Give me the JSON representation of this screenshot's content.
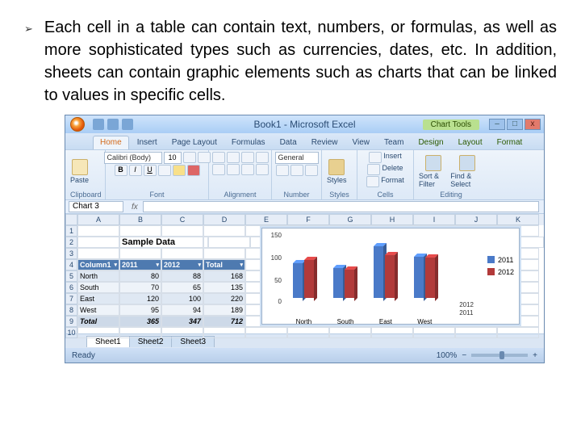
{
  "slide": {
    "bullet_text": "Each cell in a table can contain text, numbers, or formulas, as well as more sophisticated types such as currencies, dates, etc. In addition, sheets can contain graphic elements such as charts that can be linked to values in specific cells."
  },
  "titlebar": {
    "title": "Book1 - Microsoft Excel",
    "chart_tools": "Chart Tools",
    "min": "–",
    "max": "□",
    "close": "x"
  },
  "tabs": {
    "home": "Home",
    "insert": "Insert",
    "page_layout": "Page Layout",
    "formulas": "Formulas",
    "data": "Data",
    "review": "Review",
    "view": "View",
    "team": "Team",
    "design": "Design",
    "layout": "Layout",
    "format": "Format"
  },
  "ribbon": {
    "clipboard": "Clipboard",
    "paste": "Paste",
    "font_group": "Font",
    "font_name": "Calibri (Body)",
    "font_size": "10",
    "alignment": "Alignment",
    "number": "Number",
    "number_fmt": "General",
    "styles": "Styles",
    "cells": "Cells",
    "insert_btn": "Insert",
    "delete_btn": "Delete",
    "format_btn": "Format",
    "editing": "Editing",
    "sort": "Sort & Filter",
    "find": "Find & Select"
  },
  "formula": {
    "name_box": "Chart 3",
    "fx": "fx"
  },
  "columns": [
    "A",
    "B",
    "C",
    "D",
    "E",
    "F",
    "G",
    "H",
    "I",
    "J",
    "K"
  ],
  "rows": [
    "1",
    "2",
    "3",
    "4",
    "5",
    "6",
    "7",
    "8",
    "9",
    "10"
  ],
  "table": {
    "title": "Sample Data",
    "headers": [
      "Column1",
      "2011",
      "2012",
      "Total"
    ],
    "data": [
      [
        "North",
        "80",
        "88",
        "168"
      ],
      [
        "South",
        "70",
        "65",
        "135"
      ],
      [
        "East",
        "120",
        "100",
        "220"
      ],
      [
        "West",
        "95",
        "94",
        "189"
      ],
      [
        "Total",
        "365",
        "347",
        "712"
      ]
    ]
  },
  "chart_data": {
    "type": "bar",
    "categories": [
      "North",
      "South",
      "East",
      "West"
    ],
    "series": [
      {
        "name": "2011",
        "values": [
          80,
          70,
          120,
          95
        ]
      },
      {
        "name": "2012",
        "values": [
          88,
          65,
          100,
          94
        ]
      }
    ],
    "ylim": [
      0,
      150
    ],
    "yticks": [
      "0",
      "50",
      "100",
      "150"
    ],
    "depth_labels": [
      "2012",
      "2011"
    ]
  },
  "sheets": {
    "s1": "Sheet1",
    "s2": "Sheet2",
    "s3": "Sheet3"
  },
  "status": {
    "ready": "Ready",
    "zoom": "100%"
  }
}
